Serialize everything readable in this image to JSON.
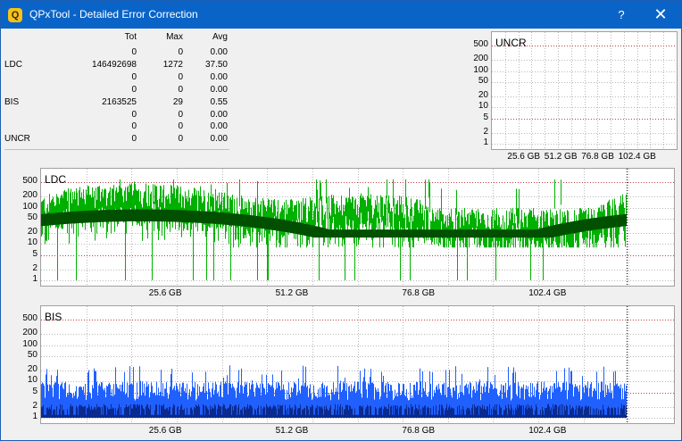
{
  "window": {
    "title": "QPxTool - Detailed Error Correction",
    "help_label": "?",
    "close_label": "✕",
    "icon_label": "Q",
    "accent_color": "#0a64c8"
  },
  "stats": {
    "headers": [
      "Tot",
      "Max",
      "Avg"
    ],
    "rows": [
      {
        "label": "",
        "tot": "0",
        "max": "0",
        "avg": "0.00"
      },
      {
        "label": "LDC",
        "tot": "146492698",
        "max": "1272",
        "avg": "37.50"
      },
      {
        "label": "",
        "tot": "0",
        "max": "0",
        "avg": "0.00"
      },
      {
        "label": "",
        "tot": "0",
        "max": "0",
        "avg": "0.00"
      },
      {
        "label": "BIS",
        "tot": "2163525",
        "max": "29",
        "avg": "0.55"
      },
      {
        "label": "",
        "tot": "0",
        "max": "0",
        "avg": "0.00"
      },
      {
        "label": "",
        "tot": "0",
        "max": "0",
        "avg": "0.00"
      },
      {
        "label": "UNCR",
        "tot": "0",
        "max": "0",
        "avg": "0.00"
      }
    ]
  },
  "chart_data": [
    {
      "type": "area",
      "title": "UNCR",
      "yscale": "log",
      "yticks": [
        "500",
        "200",
        "100",
        "50",
        "20",
        "10",
        "5",
        "2",
        "1"
      ],
      "xticks": [
        "25.6 GB",
        "51.2 GB",
        "76.8 GB",
        "102.4 GB"
      ],
      "xlim": [
        0,
        128
      ],
      "series": [
        {
          "values": []
        }
      ]
    },
    {
      "type": "area",
      "title": "LDC",
      "yscale": "log",
      "yticks": [
        "500",
        "200",
        "100",
        "50",
        "20",
        "10",
        "5",
        "2",
        "1"
      ],
      "xticks": [
        "25.6 GB",
        "51.2 GB",
        "76.8 GB",
        "102.4 GB"
      ],
      "xlim": [
        0,
        128
      ],
      "data_end_gb": 118.4,
      "max": 1272,
      "avg": 37.5,
      "series": [
        {
          "color": "#00b000"
        },
        {
          "color": "#005000"
        }
      ]
    },
    {
      "type": "area",
      "title": "BIS",
      "yscale": "log",
      "yticks": [
        "500",
        "200",
        "100",
        "50",
        "20",
        "10",
        "5",
        "2",
        "1"
      ],
      "xticks": [
        "25.6 GB",
        "51.2 GB",
        "76.8 GB",
        "102.4 GB"
      ],
      "xlim": [
        0,
        128
      ],
      "data_end_gb": 118.4,
      "max": 29,
      "avg": 0.55,
      "series": [
        {
          "color": "#2060ff"
        },
        {
          "color": "#0a2a90"
        }
      ]
    }
  ]
}
